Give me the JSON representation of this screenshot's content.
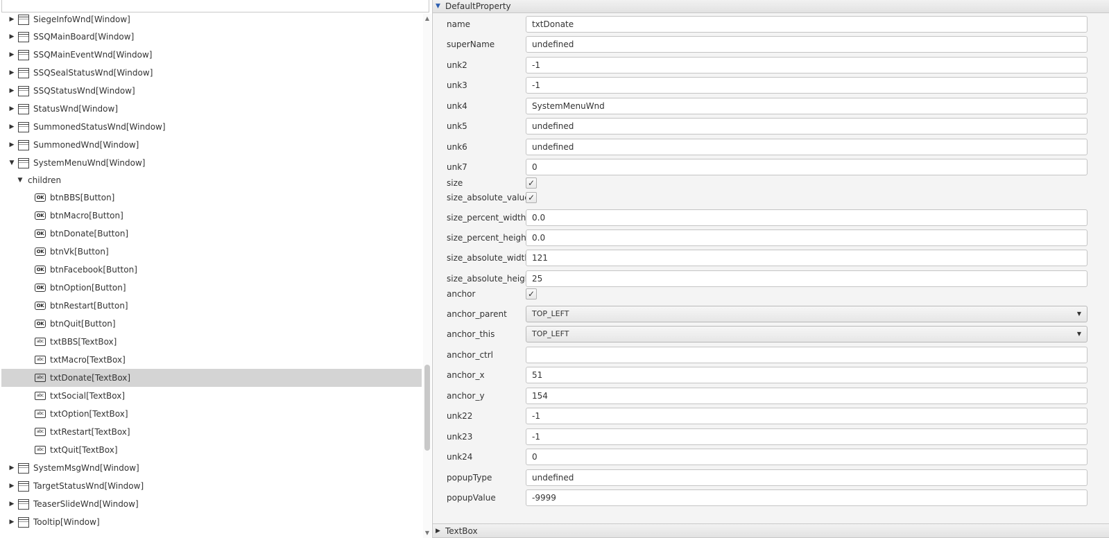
{
  "tree": {
    "rows": [
      {
        "label": "SiegeInfoWnd[Window]",
        "icon": "window",
        "arrow": "right",
        "indent": 0
      },
      {
        "label": "SSQMainBoard[Window]",
        "icon": "window",
        "arrow": "right",
        "indent": 0
      },
      {
        "label": "SSQMainEventWnd[Window]",
        "icon": "window",
        "arrow": "right",
        "indent": 0
      },
      {
        "label": "SSQSealStatusWnd[Window]",
        "icon": "window",
        "arrow": "right",
        "indent": 0
      },
      {
        "label": "SSQStatusWnd[Window]",
        "icon": "window",
        "arrow": "right",
        "indent": 0
      },
      {
        "label": "StatusWnd[Window]",
        "icon": "window",
        "arrow": "right",
        "indent": 0
      },
      {
        "label": "SummonedStatusWnd[Window]",
        "icon": "window",
        "arrow": "right",
        "indent": 0
      },
      {
        "label": "SummonedWnd[Window]",
        "icon": "window",
        "arrow": "right",
        "indent": 0
      },
      {
        "label": "SystemMenuWnd[Window]",
        "icon": "window",
        "arrow": "down",
        "indent": 0
      },
      {
        "label": "children",
        "icon": "none",
        "arrow": "down",
        "indent": 1
      },
      {
        "label": "btnBBS[Button]",
        "icon": "button",
        "arrow": "none",
        "indent": 2
      },
      {
        "label": "btnMacro[Button]",
        "icon": "button",
        "arrow": "none",
        "indent": 2
      },
      {
        "label": "btnDonate[Button]",
        "icon": "button",
        "arrow": "none",
        "indent": 2
      },
      {
        "label": "btnVk[Button]",
        "icon": "button",
        "arrow": "none",
        "indent": 2
      },
      {
        "label": "btnFacebook[Button]",
        "icon": "button",
        "arrow": "none",
        "indent": 2
      },
      {
        "label": "btnOption[Button]",
        "icon": "button",
        "arrow": "none",
        "indent": 2
      },
      {
        "label": "btnRestart[Button]",
        "icon": "button",
        "arrow": "none",
        "indent": 2
      },
      {
        "label": "btnQuit[Button]",
        "icon": "button",
        "arrow": "none",
        "indent": 2
      },
      {
        "label": "txtBBS[TextBox]",
        "icon": "textbox",
        "arrow": "none",
        "indent": 2
      },
      {
        "label": "txtMacro[TextBox]",
        "icon": "textbox",
        "arrow": "none",
        "indent": 2
      },
      {
        "label": "txtDonate[TextBox]",
        "icon": "textbox",
        "arrow": "none",
        "indent": 2,
        "selected": true
      },
      {
        "label": "txtSocial[TextBox]",
        "icon": "textbox",
        "arrow": "none",
        "indent": 2
      },
      {
        "label": "txtOption[TextBox]",
        "icon": "textbox",
        "arrow": "none",
        "indent": 2
      },
      {
        "label": "txtRestart[TextBox]",
        "icon": "textbox",
        "arrow": "none",
        "indent": 2
      },
      {
        "label": "txtQuit[TextBox]",
        "icon": "textbox",
        "arrow": "none",
        "indent": 2
      },
      {
        "label": "SystemMsgWnd[Window]",
        "icon": "window",
        "arrow": "right",
        "indent": 0
      },
      {
        "label": "TargetStatusWnd[Window]",
        "icon": "window",
        "arrow": "right",
        "indent": 0
      },
      {
        "label": "TeaserSlideWnd[Window]",
        "icon": "window",
        "arrow": "right",
        "indent": 0
      },
      {
        "label": "Tooltip[Window]",
        "icon": "window",
        "arrow": "right",
        "indent": 0
      }
    ],
    "icons": {
      "button": "OK",
      "textbox": "abc"
    }
  },
  "properties": {
    "section_title": "DefaultProperty",
    "footer_section_title": "TextBox",
    "items": [
      {
        "name": "name",
        "type": "text",
        "value": "txtDonate"
      },
      {
        "name": "superName",
        "type": "text",
        "value": "undefined"
      },
      {
        "name": "unk2",
        "type": "text",
        "value": "-1"
      },
      {
        "name": "unk3",
        "type": "text",
        "value": "-1"
      },
      {
        "name": "unk4",
        "type": "text",
        "value": "SystemMenuWnd"
      },
      {
        "name": "unk5",
        "type": "text",
        "value": "undefined"
      },
      {
        "name": "unk6",
        "type": "text",
        "value": "undefined"
      },
      {
        "name": "unk7",
        "type": "text",
        "value": "0"
      },
      {
        "name": "size",
        "type": "check",
        "checked": true
      },
      {
        "name": "size_absolute_values",
        "type": "check",
        "checked": true
      },
      {
        "name": "size_percent_width",
        "type": "text",
        "value": "0.0"
      },
      {
        "name": "size_percent_height",
        "type": "text",
        "value": "0.0"
      },
      {
        "name": "size_absolute_width",
        "type": "text",
        "value": "121"
      },
      {
        "name": "size_absolute_height",
        "type": "text",
        "value": "25"
      },
      {
        "name": "anchor",
        "type": "check",
        "checked": true
      },
      {
        "name": "anchor_parent",
        "type": "combo",
        "value": "TOP_LEFT"
      },
      {
        "name": "anchor_this",
        "type": "combo",
        "value": "TOP_LEFT"
      },
      {
        "name": "anchor_ctrl",
        "type": "text",
        "value": ""
      },
      {
        "name": "anchor_x",
        "type": "text",
        "value": "51"
      },
      {
        "name": "anchor_y",
        "type": "text",
        "value": "154"
      },
      {
        "name": "unk22",
        "type": "text",
        "value": "-1"
      },
      {
        "name": "unk23",
        "type": "text",
        "value": "-1"
      },
      {
        "name": "unk24",
        "type": "text",
        "value": "0"
      },
      {
        "name": "popupType",
        "type": "text",
        "value": "undefined"
      },
      {
        "name": "popupValue",
        "type": "text",
        "value": "-9999"
      }
    ]
  }
}
